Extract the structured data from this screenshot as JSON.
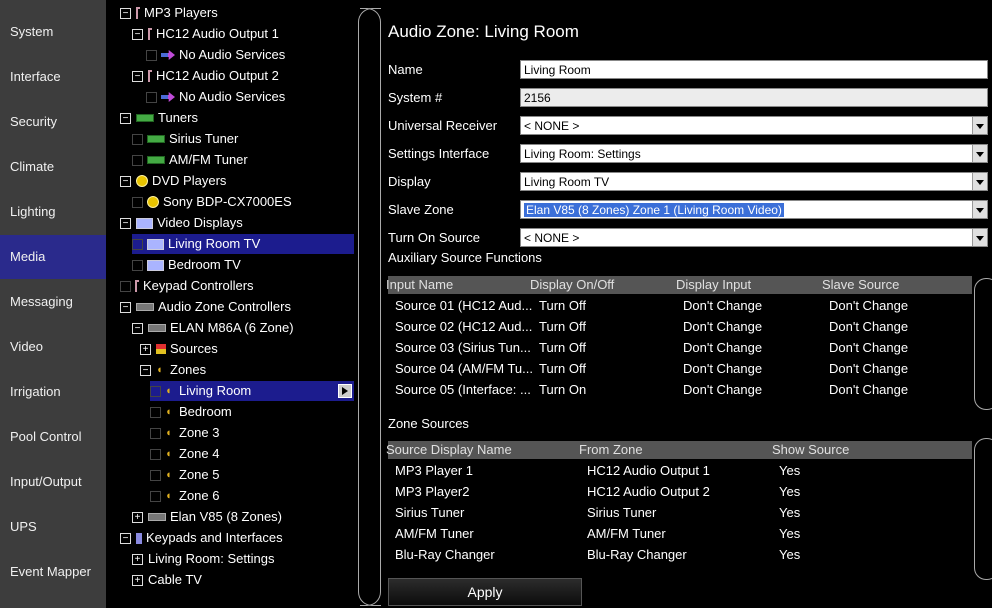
{
  "sidebar": {
    "items": [
      {
        "label": "System"
      },
      {
        "label": "Interface"
      },
      {
        "label": "Security"
      },
      {
        "label": "Climate"
      },
      {
        "label": "Lighting"
      },
      {
        "label": "Media",
        "active": true
      },
      {
        "label": "Messaging"
      },
      {
        "label": "Video"
      },
      {
        "label": "Irrigation"
      },
      {
        "label": "Pool Control"
      },
      {
        "label": "Input/Output"
      },
      {
        "label": "UPS"
      },
      {
        "label": "Event Mapper"
      }
    ]
  },
  "tree": {
    "rows": [
      {
        "label": "MP3 Players",
        "expander": "−",
        "icon": "note"
      },
      {
        "label": "HC12 Audio Output 1",
        "expander": "−",
        "icon": "note"
      },
      {
        "label": "No Audio Services",
        "icon": "arrow"
      },
      {
        "label": "HC12 Audio Output 2",
        "expander": "−",
        "icon": "note"
      },
      {
        "label": "No Audio Services",
        "icon": "arrow"
      },
      {
        "label": "Tuners",
        "expander": "−",
        "icon": "tuner"
      },
      {
        "label": "Sirius Tuner",
        "icon": "tuner"
      },
      {
        "label": "AM/FM Tuner",
        "icon": "tuner"
      },
      {
        "label": "DVD Players",
        "expander": "−",
        "icon": "disc"
      },
      {
        "label": "Sony BDP-CX7000ES",
        "icon": "disc"
      },
      {
        "label": "Video Displays",
        "expander": "−",
        "icon": "tv"
      },
      {
        "label": "Living Room TV",
        "icon": "tv",
        "selected": true
      },
      {
        "label": "Bedroom TV",
        "icon": "tv"
      },
      {
        "label": "Keypad Controllers",
        "icon": "note"
      },
      {
        "label": "Audio Zone Controllers",
        "expander": "−",
        "icon": "ctrl"
      },
      {
        "label": "ELAN M86A (6 Zone)",
        "expander": "−",
        "icon": "ctrl"
      },
      {
        "label": "Sources",
        "expander": "+",
        "icon": "src"
      },
      {
        "label": "Zones",
        "expander": "−",
        "icon": "spk"
      },
      {
        "label": "Living Room",
        "icon": "spk",
        "selected": true
      },
      {
        "label": "Bedroom",
        "icon": "spk"
      },
      {
        "label": "Zone 3",
        "icon": "spk"
      },
      {
        "label": "Zone 4",
        "icon": "spk"
      },
      {
        "label": "Zone 5",
        "icon": "spk"
      },
      {
        "label": "Zone 6",
        "icon": "spk"
      },
      {
        "label": "Elan V85 (8 Zones)",
        "expander": "+",
        "icon": "ctrl"
      },
      {
        "label": "Keypads and Interfaces",
        "expander": "−",
        "icon": "keypad"
      },
      {
        "label": "Living Room: Settings",
        "expander": "+"
      },
      {
        "label": "Cable TV",
        "expander": "+"
      }
    ]
  },
  "main": {
    "title": "Audio Zone: Living Room",
    "fields": [
      {
        "label": "Name",
        "value": "Living Room",
        "kind": "text"
      },
      {
        "label": "System #",
        "value": "2156",
        "kind": "readonly"
      },
      {
        "label": "Universal Receiver",
        "value": "< NONE >",
        "kind": "select"
      },
      {
        "label": "Settings Interface",
        "value": "Living Room: Settings",
        "kind": "select"
      },
      {
        "label": "Display",
        "value": "Living Room TV",
        "kind": "select"
      },
      {
        "label": "Slave Zone",
        "value": "Elan V85 (8 Zones) Zone 1 (Living Room Video)",
        "kind": "select-highlight"
      },
      {
        "label": "Turn On Source",
        "value": "< NONE >",
        "kind": "select"
      }
    ],
    "aux": {
      "title": "Auxiliary Source Functions",
      "headers": [
        "Input Name",
        "Display On/Off",
        "Display Input",
        "Slave Source"
      ],
      "rows": [
        [
          "Source 01 (HC12 Aud...",
          "Turn Off",
          "Don't Change",
          "Don't Change"
        ],
        [
          "Source 02 (HC12 Aud...",
          "Turn Off",
          "Don't Change",
          "Don't Change"
        ],
        [
          "Source 03 (Sirius Tun...",
          "Turn Off",
          "Don't Change",
          "Don't Change"
        ],
        [
          "Source 04 (AM/FM Tu...",
          "Turn Off",
          "Don't Change",
          "Don't Change"
        ],
        [
          "Source 05 (Interface: ...",
          "Turn On",
          "Don't Change",
          "Don't Change"
        ]
      ]
    },
    "zone": {
      "title": "Zone Sources",
      "headers": [
        "Source Display Name",
        "From Zone",
        "Show Source"
      ],
      "rows": [
        [
          "MP3 Player 1",
          "HC12 Audio Output 1",
          "Yes"
        ],
        [
          "MP3 Player2",
          "HC12 Audio Output 2",
          "Yes"
        ],
        [
          "Sirius Tuner",
          "Sirius Tuner",
          "Yes"
        ],
        [
          "AM/FM Tuner",
          "AM/FM Tuner",
          "Yes"
        ],
        [
          "Blu-Ray Changer",
          "Blu-Ray Changer",
          "Yes"
        ]
      ]
    },
    "apply_label": "Apply"
  }
}
